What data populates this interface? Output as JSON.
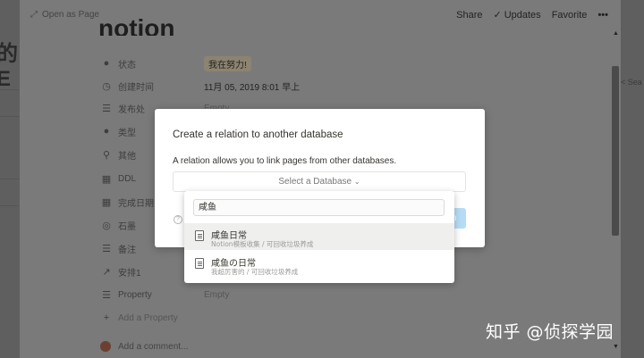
{
  "background": {
    "left_title_fragment": "的E",
    "right_search_fragment": "< Sea"
  },
  "peek": {
    "open_as_page": "Open as Page",
    "share": "Share",
    "updates": "Updates",
    "favorite": "Favorite",
    "more": "•••",
    "page_title": "notion",
    "properties": [
      {
        "icon": "●",
        "icon_name": "status-icon",
        "name": "状态",
        "value": "我在努力!",
        "type": "tag"
      },
      {
        "icon": "◷",
        "icon_name": "clock-icon",
        "name": "创建时间",
        "value": "11月 05, 2019 8:01 早上",
        "type": "text"
      },
      {
        "icon": "☰",
        "icon_name": "list-icon",
        "name": "发布处",
        "value": "Empty",
        "type": "empty"
      },
      {
        "icon": "●",
        "icon_name": "select-icon",
        "name": "类型",
        "value": "",
        "type": "empty"
      },
      {
        "icon": "⚲",
        "icon_name": "paperclip-icon",
        "name": "其他",
        "value": "",
        "type": "empty"
      },
      {
        "icon": "▦",
        "icon_name": "calendar-icon",
        "name": "DDL",
        "value": "",
        "type": "empty"
      },
      {
        "icon": "▦",
        "icon_name": "calendar-icon",
        "name": "完成日期",
        "value": "",
        "type": "empty"
      },
      {
        "icon": "◎",
        "icon_name": "link-icon",
        "name": "石墨",
        "value": "",
        "type": "empty"
      },
      {
        "icon": "☰",
        "icon_name": "text-icon",
        "name": "备注",
        "value": "",
        "type": "empty"
      },
      {
        "icon": "↗",
        "icon_name": "relation-icon",
        "name": "安排1",
        "value": "",
        "type": "empty"
      },
      {
        "icon": "☰",
        "icon_name": "text-icon",
        "name": "Property",
        "value": "Empty",
        "type": "empty"
      }
    ],
    "add_property": "Add a Property",
    "add_comment": "Add a comment..."
  },
  "dialog": {
    "title": "Create a relation to another database",
    "description": "A relation allows you to link pages from other databases.",
    "select_placeholder": "Select a Database",
    "help": "?",
    "create_fragment": "n"
  },
  "dropdown": {
    "search_value": "咸鱼",
    "options": [
      {
        "name": "咸鱼日常",
        "path": "Notion模板收集 / 可回收垃圾养成",
        "selected": true
      },
      {
        "name": "咸鱼の日常",
        "path": "我超厉害的 / 可回收垃圾养成",
        "selected": false
      }
    ]
  },
  "watermark": "知乎 @侦探学园"
}
